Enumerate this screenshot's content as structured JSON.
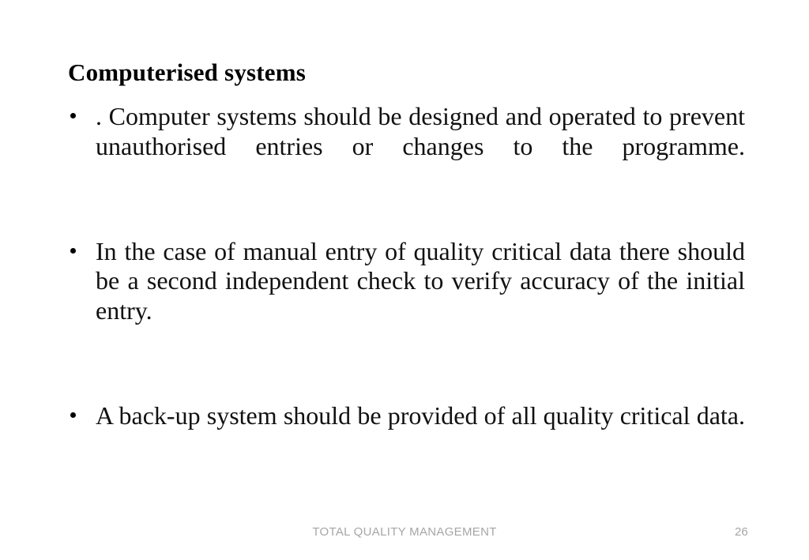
{
  "slide": {
    "title": "Computerised systems",
    "bullets": [
      {
        "marker": "bullet-dot",
        "text": ". Computer systems should be designed and operated to prevent unauthorised entries or changes to the programme."
      },
      {
        "marker": "bullet-dot",
        "text": " In the case of manual entry of quality critical data there should be a second independent check to verify accuracy of the initial entry."
      },
      {
        "marker": "bullet-dot",
        "text": " A back-up system should be provided of all quality critical data."
      }
    ],
    "footer": {
      "title": "TOTAL QUALITY MANAGEMENT",
      "page_number": "26"
    },
    "colors": {
      "background": "#ffffff",
      "title_text": "#000000",
      "body_text": "#111111",
      "footer_text": "#a6a6a6"
    }
  }
}
